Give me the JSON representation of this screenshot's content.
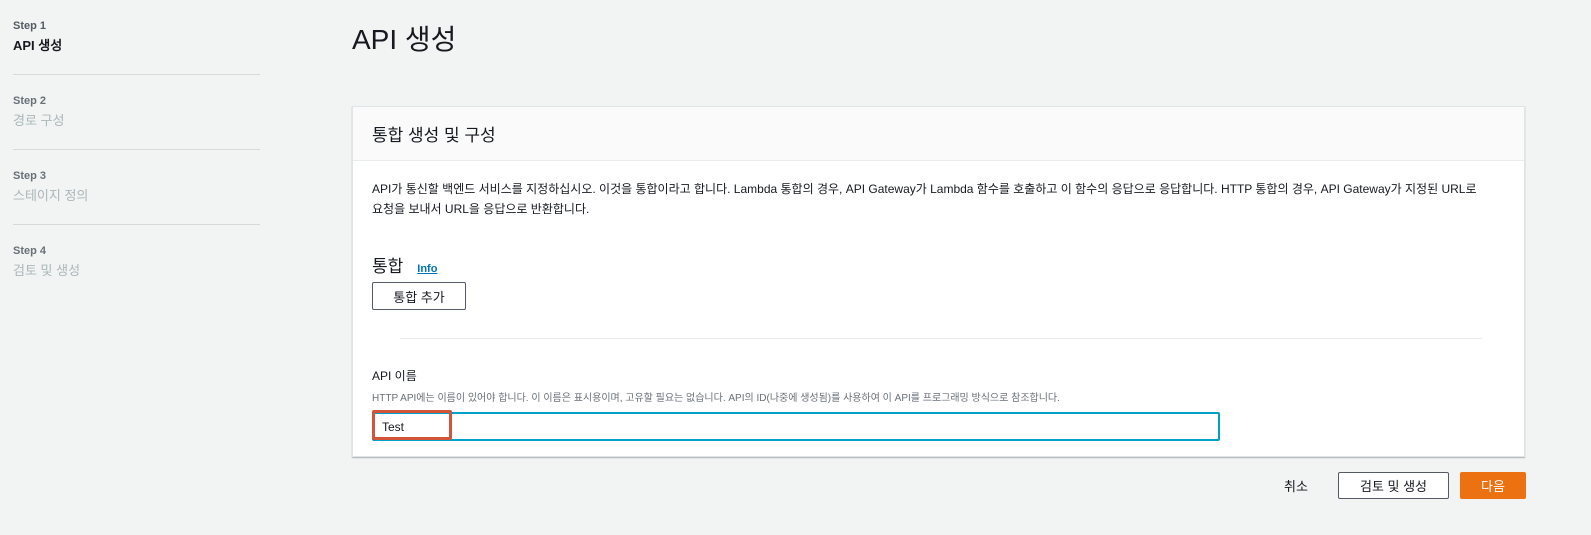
{
  "sidebar": {
    "steps": [
      {
        "number": "Step 1",
        "title": "API 생성"
      },
      {
        "number": "Step 2",
        "title": "경로 구성"
      },
      {
        "number": "Step 3",
        "title": "스테이지 정의"
      },
      {
        "number": "Step 4",
        "title": "검토 및 생성"
      }
    ]
  },
  "page": {
    "title": "API 생성"
  },
  "panel": {
    "header": "통합 생성 및 구성",
    "description": "API가 통신할 백엔드 서비스를 지정하십시오. 이것을 통합이라고 합니다. Lambda 통합의 경우, API Gateway가 Lambda 함수를 호출하고 이 함수의 응답으로 응답합니다. HTTP 통합의 경우, API Gateway가 지정된 URL로 요청을 보내서 URL을 응답으로 반환합니다.",
    "integration_label": "통합",
    "info_link": "Info",
    "add_integration_label": "통합 추가",
    "api_name_label": "API 이름",
    "api_name_description": "HTTP API에는 이름이 있어야 합니다. 이 이름은 표시용이며, 고유할 필요는 없습니다. API의 ID(나중에 생성됨)를 사용하여 이 API를 프로그래밍 방식으로 참조합니다.",
    "api_name_value": "Test"
  },
  "footer": {
    "cancel_label": "취소",
    "review_label": "검토 및 생성",
    "next_label": "다음"
  },
  "colors": {
    "primary_button": "#ec7211",
    "input_focus": "#00a1c9",
    "link": "#0073bb",
    "highlight": "#d2553a"
  }
}
